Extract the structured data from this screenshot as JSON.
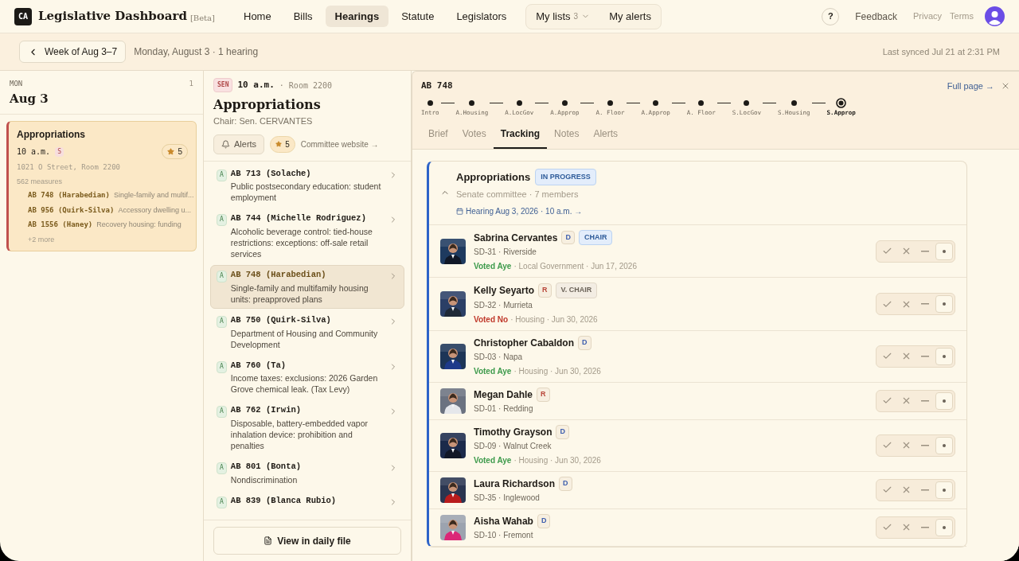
{
  "brand": {
    "logo": "CA",
    "title": "Legislative Dashboard",
    "tag": "[Beta]"
  },
  "nav": [
    {
      "label": "Home",
      "selected": false
    },
    {
      "label": "Bills",
      "selected": false
    },
    {
      "label": "Hearings",
      "selected": true
    },
    {
      "label": "Statute",
      "selected": false
    },
    {
      "label": "Legislators",
      "selected": false
    }
  ],
  "nav_group": {
    "lists_label": "My lists",
    "lists_count": "3",
    "alerts_label": "My alerts"
  },
  "header_right": {
    "help": "?",
    "feedback": "Feedback",
    "privacy": "Privacy",
    "terms": "Terms"
  },
  "subbar": {
    "week_button": "Week of Aug 3–7",
    "summary": "Monday, August 3 · 1 hearing",
    "synced": "Last synced Jul 21 at 2:31 PM"
  },
  "day": {
    "weekday": "MON",
    "count": "1",
    "date": "Aug 3",
    "hearings": [
      {
        "title": "Appropriations",
        "time": "10 a.m.",
        "chamber": "S",
        "stars": "5",
        "address": "1021 O Street, Room 2200",
        "measures": "562 measures",
        "selected": true,
        "bills": [
          {
            "id": "AB 748 (Harabedian)",
            "desc": "Single-family and multif..."
          },
          {
            "id": "AB 956 (Quirk-Silva)",
            "desc": "Accessory dwelling u..."
          },
          {
            "id": "AB 1556 (Haney)",
            "desc": "Recovery housing: funding"
          }
        ],
        "more": "+2 more"
      }
    ]
  },
  "hearing": {
    "chamber": "SEN",
    "time": "10 a.m.",
    "room": "· Room 2200",
    "title": "Appropriations",
    "chair": "Chair: Sen. CERVANTES",
    "alerts_button": "Alerts",
    "stars": "5",
    "website_link": "Committee website →",
    "footer_button": "View in daily file",
    "bills": [
      {
        "chamber": "A",
        "id": "AB 713 (Solache)",
        "desc": "Public postsecondary education: student employment",
        "selected": false
      },
      {
        "chamber": "A",
        "id": "AB 744 (Michelle Rodriguez)",
        "desc": "Alcoholic beverage control: tied-house restrictions: exceptions: off-sale retail services",
        "selected": false
      },
      {
        "chamber": "A",
        "id": "AB 748 (Harabedian)",
        "desc": "Single-family and multifamily housing units: preapproved plans",
        "selected": true
      },
      {
        "chamber": "A",
        "id": "AB 750 (Quirk-Silva)",
        "desc": "Department of Housing and Community Development",
        "selected": false
      },
      {
        "chamber": "A",
        "id": "AB 760 (Ta)",
        "desc": "Income taxes: exclusions: 2026 Garden Grove chemical leak. (Tax Levy)",
        "selected": false
      },
      {
        "chamber": "A",
        "id": "AB 762 (Irwin)",
        "desc": "Disposable, battery-embedded vapor inhalation device: prohibition and penalties",
        "selected": false
      },
      {
        "chamber": "A",
        "id": "AB 801 (Bonta)",
        "desc": "Nondiscrimination",
        "selected": false
      },
      {
        "chamber": "A",
        "id": "AB 839 (Blanca Rubio)",
        "selected": false
      }
    ]
  },
  "detail": {
    "bill": "AB 748",
    "full_page": "Full page →",
    "stages": [
      {
        "label": "Intro",
        "current": false
      },
      {
        "label": "A.Housing",
        "current": false
      },
      {
        "label": "A.LocGov",
        "current": false
      },
      {
        "label": "A.Approp",
        "current": false
      },
      {
        "label": "A. Floor",
        "current": false
      },
      {
        "label": "A.Approp",
        "current": false
      },
      {
        "label": "A. Floor",
        "current": false
      },
      {
        "label": "S.LocGov",
        "current": false
      },
      {
        "label": "S.Housing",
        "current": false
      },
      {
        "label": "S.Approp",
        "current": true
      }
    ],
    "tabs": [
      {
        "label": "Brief",
        "selected": false
      },
      {
        "label": "Votes",
        "selected": false
      },
      {
        "label": "Tracking",
        "selected": true
      },
      {
        "label": "Notes",
        "selected": false
      },
      {
        "label": "Alerts",
        "selected": false
      }
    ],
    "committee": {
      "title": "Appropriations",
      "status": "IN PROGRESS",
      "subtitle": "Senate committee · 7 members",
      "hearing_link": "Hearing Aug 3, 2026 · 10 a.m. →",
      "expanded": true,
      "members": [
        {
          "name": "Sabrina Cervantes",
          "party": {
            "label": "D",
            "color": "#3f5fae"
          },
          "role": {
            "kind": "chair",
            "label": "CHAIR"
          },
          "district": "SD-31 · Riverside",
          "vote": {
            "kind": "aye",
            "label": "Voted Aye",
            "detail": "· Local Government · Jun 17, 2026"
          }
        },
        {
          "name": "Kelly Seyarto",
          "party": {
            "label": "R",
            "color": "#b9473a"
          },
          "role": {
            "kind": "vice",
            "label": "V. CHAIR"
          },
          "district": "SD-32 · Murrieta",
          "vote": {
            "kind": "no",
            "label": "Voted No",
            "detail": "· Housing · Jun 30, 2026"
          }
        },
        {
          "name": "Christopher Cabaldon",
          "party": {
            "label": "D",
            "color": "#3f5fae"
          },
          "district": "SD-03 · Napa",
          "vote": {
            "kind": "aye",
            "label": "Voted Aye",
            "detail": "· Housing · Jun 30, 2026"
          }
        },
        {
          "name": "Megan Dahle",
          "party": {
            "label": "R",
            "color": "#b9473a"
          },
          "district": "SD-01 · Redding"
        },
        {
          "name": "Timothy Grayson",
          "party": {
            "label": "D",
            "color": "#3f5fae"
          },
          "district": "SD-09 · Walnut Creek",
          "vote": {
            "kind": "aye",
            "label": "Voted Aye",
            "detail": "· Housing · Jun 30, 2026"
          }
        },
        {
          "name": "Laura Richardson",
          "party": {
            "label": "D",
            "color": "#3f5fae"
          },
          "district": "SD-35 · Inglewood"
        },
        {
          "name": "Aisha Wahab",
          "party": {
            "label": "D",
            "color": "#3f5fae"
          },
          "district": "SD-10 · Fremont"
        }
      ]
    },
    "vote_options": [
      {
        "kind": "aye",
        "selected": false
      },
      {
        "kind": "no",
        "selected": false
      },
      {
        "kind": "abstain",
        "selected": false
      },
      {
        "kind": "none",
        "selected": true
      }
    ]
  }
}
